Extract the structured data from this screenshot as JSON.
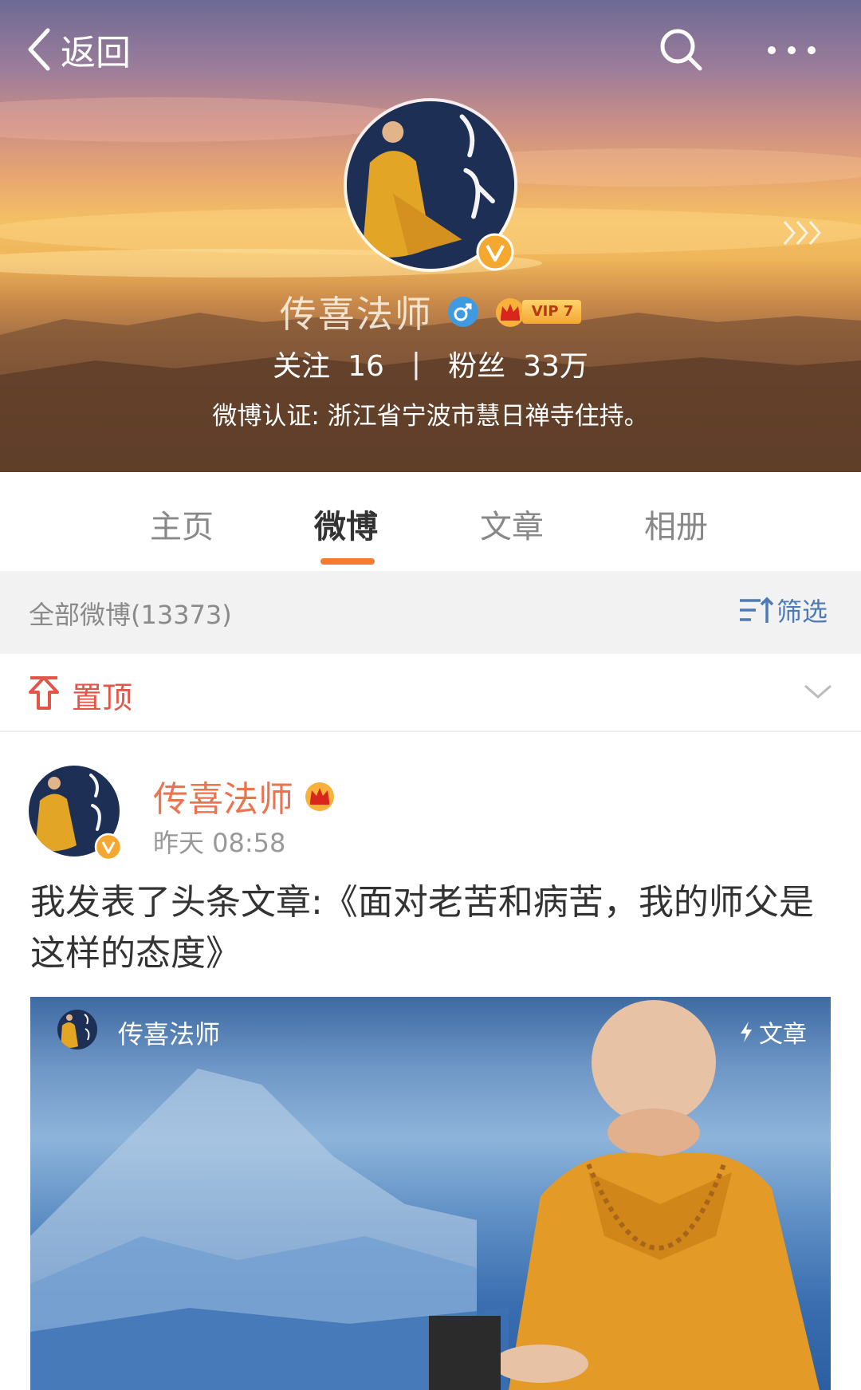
{
  "topbar": {
    "back_label": "返回"
  },
  "profile": {
    "name": "传喜法师",
    "vip_label": "VIP 7",
    "following_label": "关注",
    "following_count": "16",
    "separator": "|",
    "followers_label": "粉丝",
    "followers_count": "33万",
    "verification": "微博认证: 浙江省宁波市慧日禅寺住持。"
  },
  "tabs": [
    {
      "label": "主页",
      "active": false
    },
    {
      "label": "微博",
      "active": true
    },
    {
      "label": "文章",
      "active": false
    },
    {
      "label": "相册",
      "active": false
    }
  ],
  "filter_bar": {
    "count_label": "全部微博(13373)",
    "filter_label": "筛选"
  },
  "pinned": {
    "label": "置顶"
  },
  "post": {
    "author": "传喜法师",
    "time": "昨天 08:58",
    "text": "我发表了头条文章:《面对老苦和病苦，我的师父是这样的态度》",
    "card": {
      "author": "传喜法师",
      "tag": "文章"
    }
  },
  "colors": {
    "accent_orange": "#f57b30",
    "author_orange": "#eb7350",
    "pinned_red": "#e2564a",
    "filter_blue": "#4e7ab5",
    "verified_gold": "#f4a830",
    "gender_blue": "#3f9be0"
  },
  "icons": {
    "back": "chevron-left-icon",
    "search": "search-icon",
    "more": "more-dots-icon",
    "verified": "verified-v-icon",
    "gender": "male-icon",
    "crown": "crown-icon",
    "filter": "filter-sort-icon",
    "pin": "pin-top-icon",
    "collapse": "chevron-down-icon",
    "article": "lightning-icon"
  }
}
